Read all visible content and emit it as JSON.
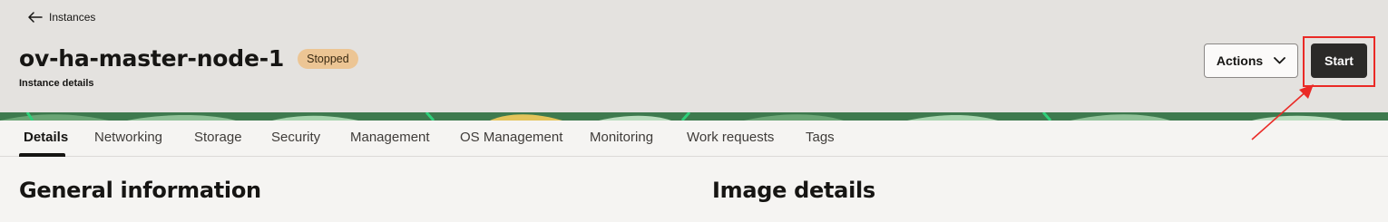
{
  "breadcrumb": {
    "back_label": "Instances"
  },
  "instance": {
    "name": "ov-ha-master-node-1",
    "status": "Stopped",
    "subtitle": "Instance details"
  },
  "toolbar": {
    "actions_label": "Actions",
    "start_label": "Start"
  },
  "tabs": [
    {
      "label": "Details",
      "active": true
    },
    {
      "label": "Networking"
    },
    {
      "label": "Storage"
    },
    {
      "label": "Security"
    },
    {
      "label": "Management"
    },
    {
      "label": "OS Management"
    },
    {
      "label": "Monitoring"
    },
    {
      "label": "Work requests"
    },
    {
      "label": "Tags"
    }
  ],
  "sections": {
    "general": "General information",
    "image": "Image details"
  },
  "colors": {
    "header_bg": "#e4e2df",
    "status_badge": "#ecc594",
    "primary_button": "#2b2a28",
    "annotation_red": "#ea2a26"
  },
  "icons": {
    "back": "arrow-left-icon",
    "actions_caret": "chevron-down-icon"
  }
}
